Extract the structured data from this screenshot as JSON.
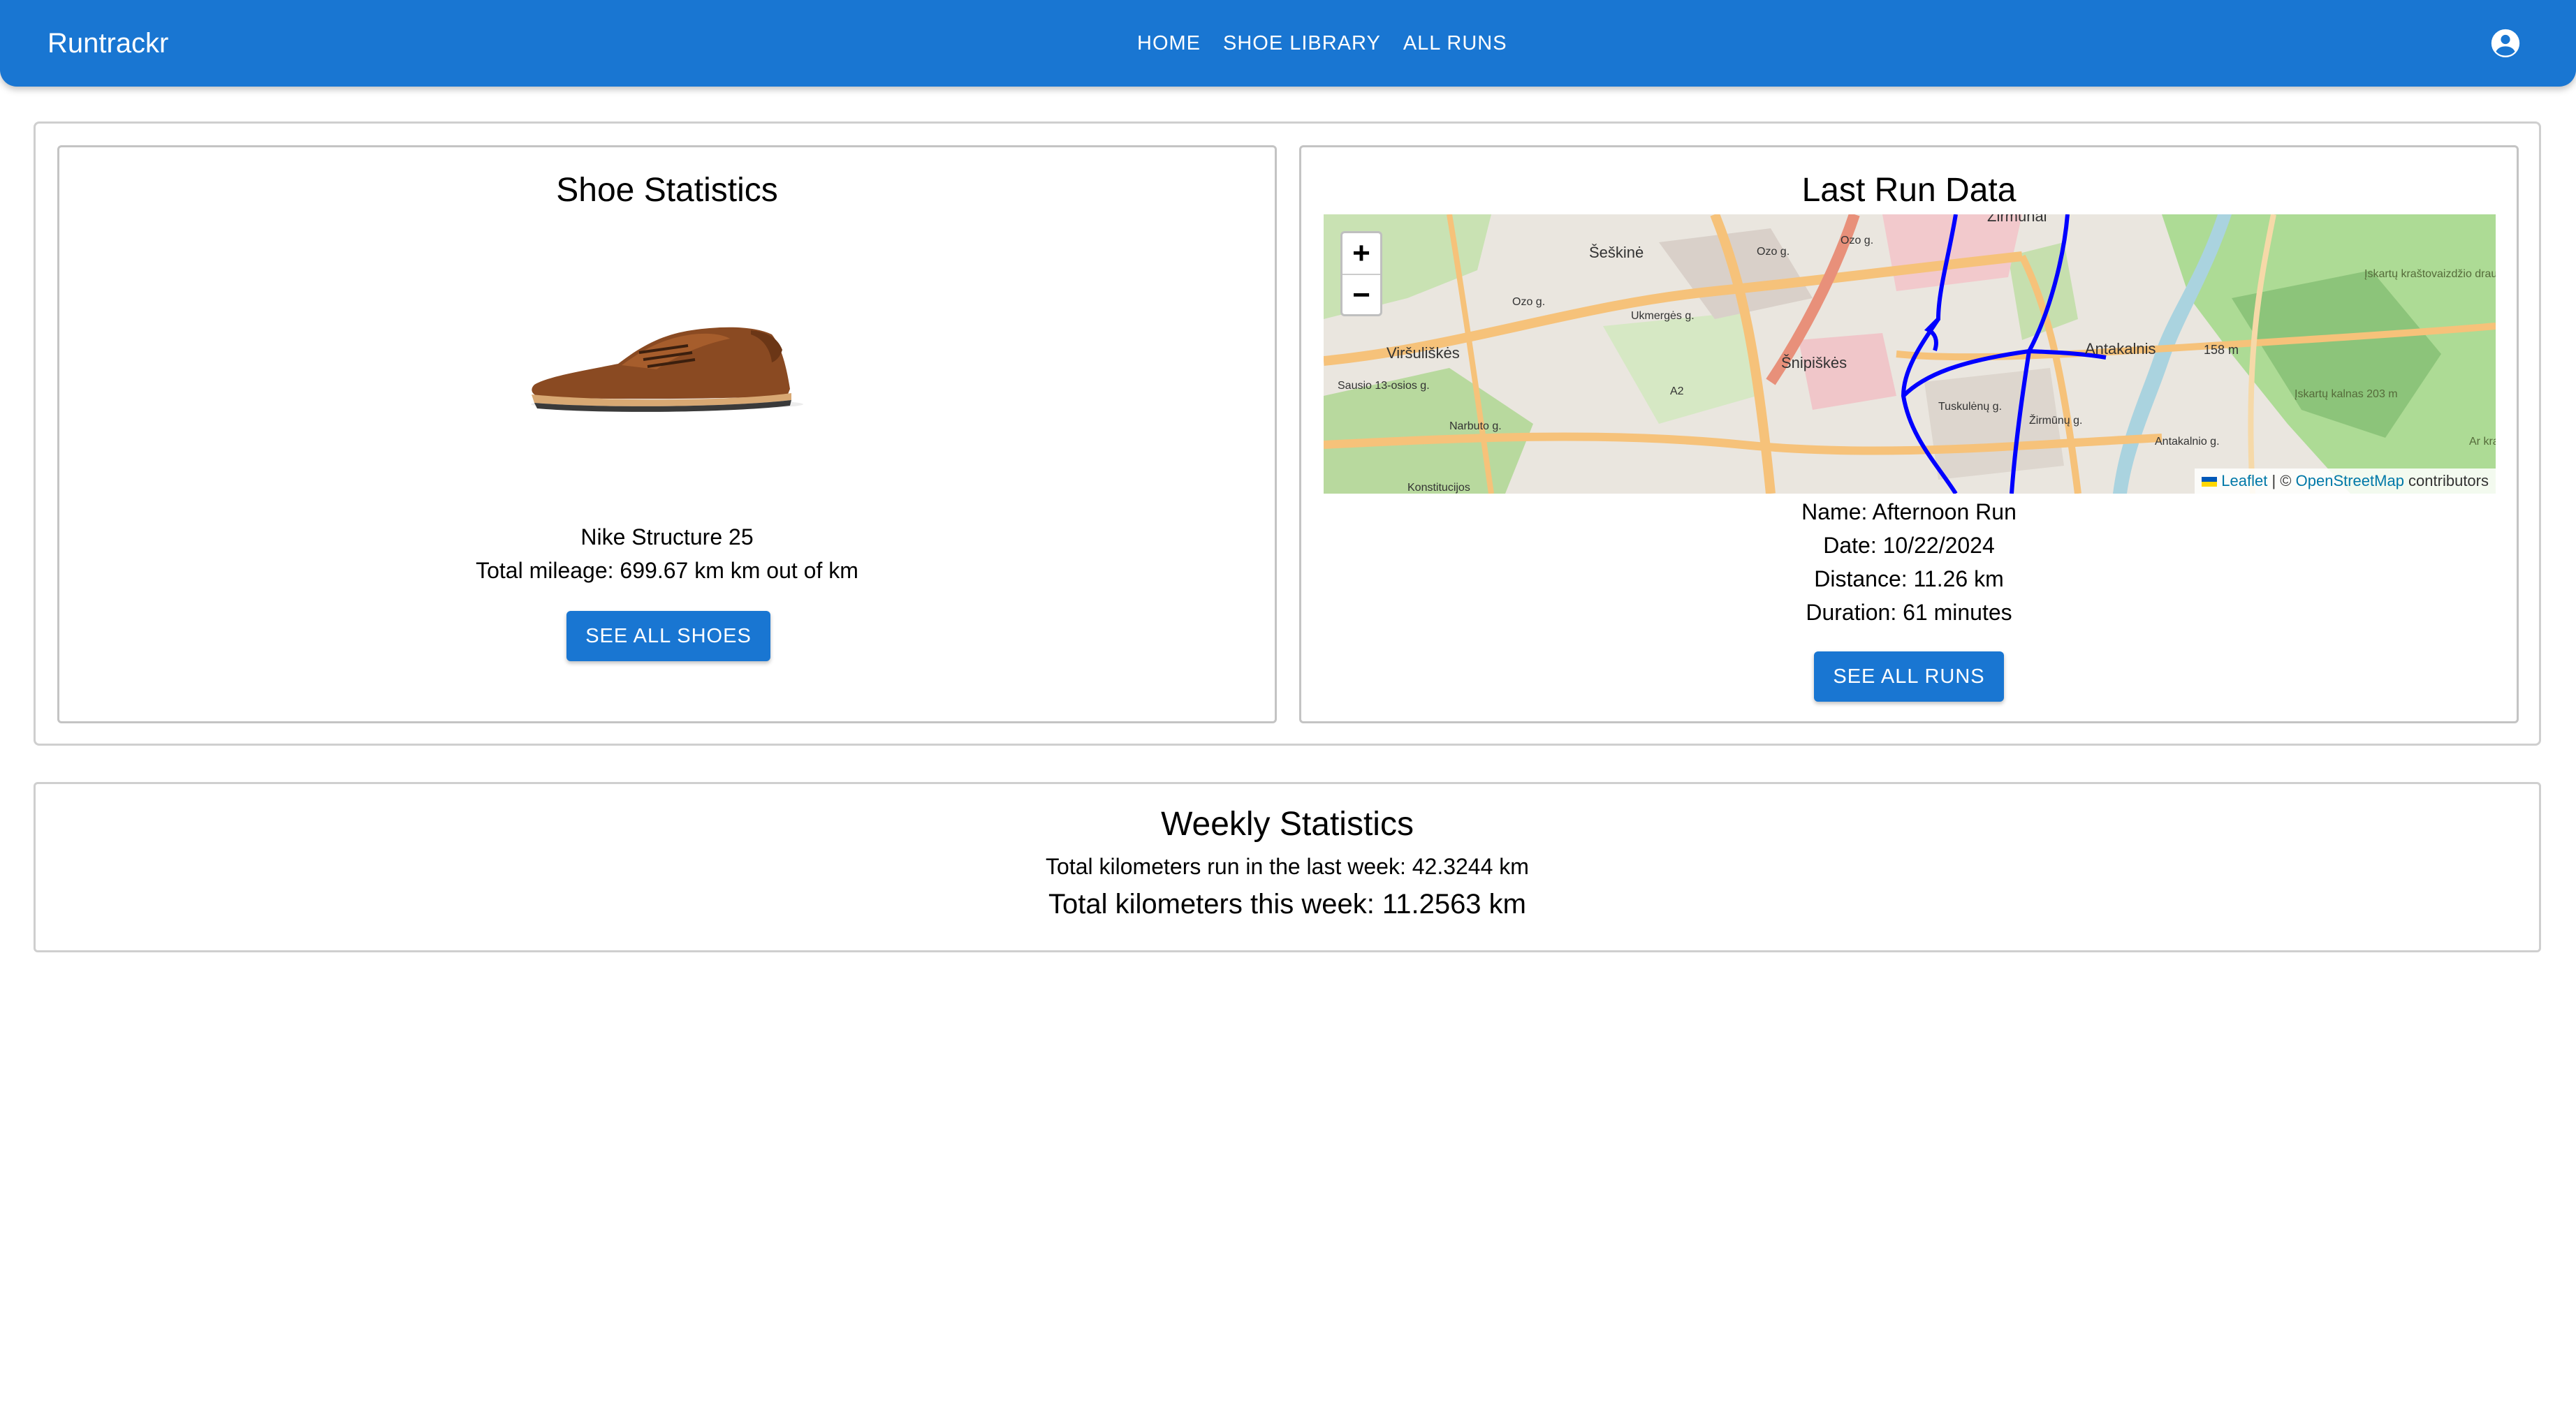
{
  "header": {
    "brand": "Runtrackr",
    "nav": [
      "HOME",
      "SHOE LIBRARY",
      "ALL RUNS"
    ],
    "account_icon": "account-circle-icon"
  },
  "shoe_stats": {
    "title": "Shoe Statistics",
    "shoe_name": "Nike Structure 25",
    "mileage": "Total mileage: 699.67 km km out of km",
    "button": "SEE ALL SHOES"
  },
  "last_run": {
    "title": "Last Run Data",
    "map": {
      "zoom_in": "+",
      "zoom_out": "−",
      "labels": [
        "Žirmūnai",
        "Šeškinė",
        "Viršuliškės",
        "Šnipiškės",
        "Antakalnis",
        "158 m",
        "Ozo g.",
        "Ozo g.",
        "Ozo g.",
        "A2",
        "Narbuto g.",
        "Ukmergės g.",
        "Tuskulėnų g.",
        "Žirmūnų g.",
        "Antakalnio g.",
        "Sausio 13-osios g.",
        "Konstitucijos",
        "Įskartų kraštovaizdžio draustinis",
        "Įskartų kalnas 203 m",
        "Ar kraš"
      ],
      "attribution_leaflet": "Leaflet",
      "attribution_sep": " | © ",
      "attribution_osm": "OpenStreetMap",
      "attribution_tail": " contributors",
      "route_color": "#0000ff"
    },
    "name": "Name: Afternoon Run",
    "date": "Date: 10/22/2024",
    "distance": "Distance: 11.26 km",
    "duration": "Duration: 61 minutes",
    "button": "SEE ALL RUNS"
  },
  "weekly": {
    "title": "Weekly Statistics",
    "last_week": "Total kilometers run in the last week: 42.3244 km",
    "this_week": "Total kilometers this week: 11.2563 km"
  },
  "colors": {
    "primary": "#1976d2",
    "route": "#0000ff"
  }
}
